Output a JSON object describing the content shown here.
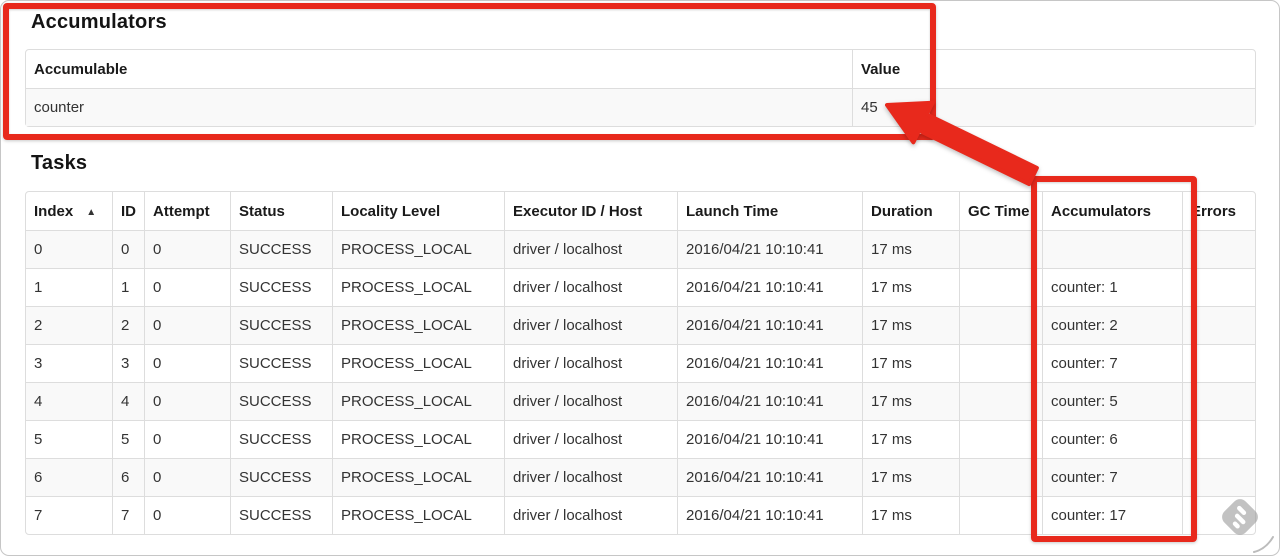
{
  "colors": {
    "annotation_red": "#e8291c",
    "row_stripe": "#f9f9f9",
    "table_border": "#dddddd"
  },
  "accumulators": {
    "title": "Accumulators",
    "headers": [
      "Accumulable",
      "Value"
    ],
    "rows": [
      [
        "counter",
        "45"
      ]
    ]
  },
  "tasks": {
    "title": "Tasks",
    "sort_indicator": "▲",
    "headers": [
      "Index",
      "ID",
      "Attempt",
      "Status",
      "Locality Level",
      "Executor ID / Host",
      "Launch Time",
      "Duration",
      "GC Time",
      "Accumulators",
      "Errors"
    ],
    "rows": [
      [
        "0",
        "0",
        "0",
        "SUCCESS",
        "PROCESS_LOCAL",
        "driver / localhost",
        "2016/04/21 10:10:41",
        "17 ms",
        "",
        "",
        ""
      ],
      [
        "1",
        "1",
        "0",
        "SUCCESS",
        "PROCESS_LOCAL",
        "driver / localhost",
        "2016/04/21 10:10:41",
        "17 ms",
        "",
        "counter: 1",
        ""
      ],
      [
        "2",
        "2",
        "0",
        "SUCCESS",
        "PROCESS_LOCAL",
        "driver / localhost",
        "2016/04/21 10:10:41",
        "17 ms",
        "",
        "counter: 2",
        ""
      ],
      [
        "3",
        "3",
        "0",
        "SUCCESS",
        "PROCESS_LOCAL",
        "driver / localhost",
        "2016/04/21 10:10:41",
        "17 ms",
        "",
        "counter: 7",
        ""
      ],
      [
        "4",
        "4",
        "0",
        "SUCCESS",
        "PROCESS_LOCAL",
        "driver / localhost",
        "2016/04/21 10:10:41",
        "17 ms",
        "",
        "counter: 5",
        ""
      ],
      [
        "5",
        "5",
        "0",
        "SUCCESS",
        "PROCESS_LOCAL",
        "driver / localhost",
        "2016/04/21 10:10:41",
        "17 ms",
        "",
        "counter: 6",
        ""
      ],
      [
        "6",
        "6",
        "0",
        "SUCCESS",
        "PROCESS_LOCAL",
        "driver / localhost",
        "2016/04/21 10:10:41",
        "17 ms",
        "",
        "counter: 7",
        ""
      ],
      [
        "7",
        "7",
        "0",
        "SUCCESS",
        "PROCESS_LOCAL",
        "driver / localhost",
        "2016/04/21 10:10:41",
        "17 ms",
        "",
        "counter: 17",
        ""
      ]
    ]
  }
}
